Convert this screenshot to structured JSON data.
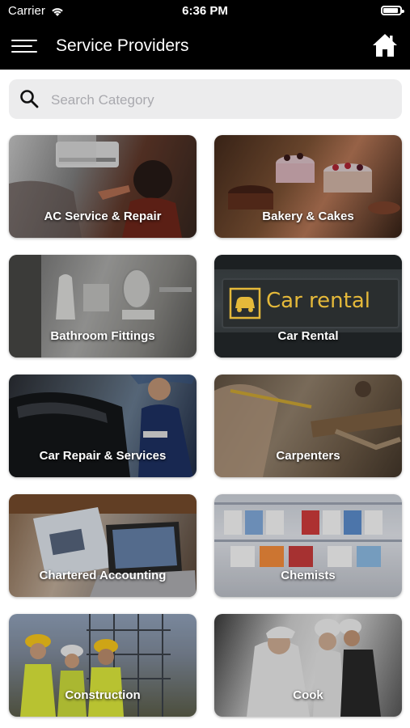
{
  "status_bar": {
    "carrier": "Carrier",
    "time": "6:36 PM",
    "battery_level": 0.9
  },
  "header": {
    "title": "Service Providers",
    "menu_icon": "hamburger-menu-icon",
    "home_icon": "home-icon"
  },
  "search": {
    "placeholder": "Search Category",
    "value": "",
    "icon": "search-icon"
  },
  "categories": [
    {
      "label": "AC Service & Repair"
    },
    {
      "label": "Bakery & Cakes"
    },
    {
      "label": "Bathroom Fittings"
    },
    {
      "label": "Car Rental",
      "sign_text": "Car rental"
    },
    {
      "label": "Car Repair & Services"
    },
    {
      "label": "Carpenters"
    },
    {
      "label": "Chartered Accounting"
    },
    {
      "label": "Chemists"
    },
    {
      "label": "Construction"
    },
    {
      "label": "Cook"
    }
  ],
  "colors": {
    "header_bg": "#000000",
    "search_bg": "#ececed",
    "placeholder": "#a9a9ae",
    "sign_text": "#e5b93a"
  }
}
